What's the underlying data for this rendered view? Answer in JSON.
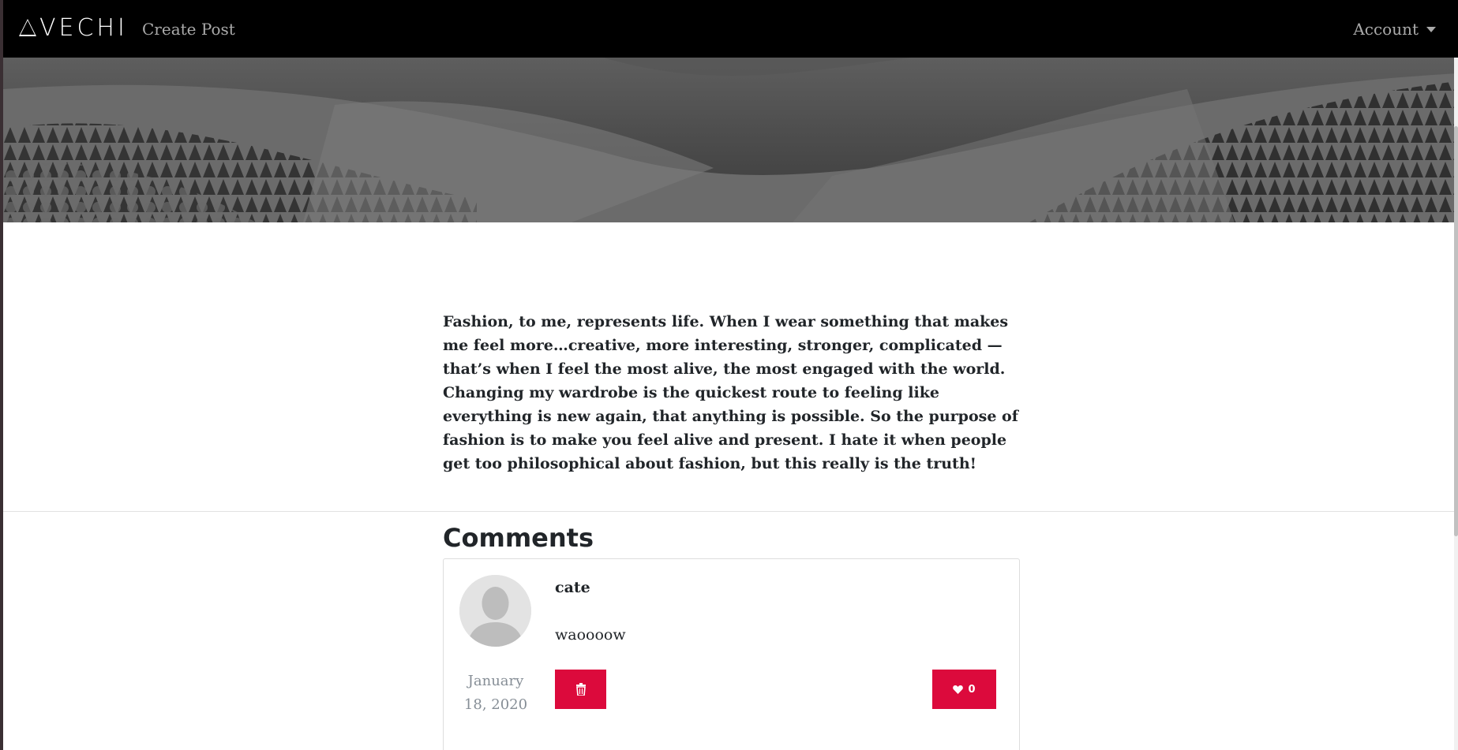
{
  "navbar": {
    "brand": "VECHI",
    "create_post": "Create Post",
    "account": "Account"
  },
  "hero": {
    "caption": "Fashion..."
  },
  "article": {
    "body": "Fashion, to me, represents life. When I wear something that makes me feel more…creative, more interesting, stronger, complicated — that’s when I feel the most alive, the most engaged with the world. Changing my wardrobe is the quickest route to feeling like everything is new again, that anything is possible. So the purpose of fashion is to make you feel alive and present. I hate it when people get too philosophical about fashion, but this really is the truth!"
  },
  "comments": {
    "title": "Comments",
    "items": [
      {
        "user": "cate",
        "text": "waoooow",
        "date": "January 18, 2020",
        "likes": "0"
      }
    ]
  },
  "icons": {
    "logo": "triangle-logo-icon",
    "account_caret": "caret-down-icon",
    "avatar": "user-avatar-icon",
    "delete": "trash-icon",
    "like": "heart-icon"
  },
  "colors": {
    "navbar_bg": "#000000",
    "accent": "#dc0a3c",
    "muted_text": "#868e96"
  }
}
